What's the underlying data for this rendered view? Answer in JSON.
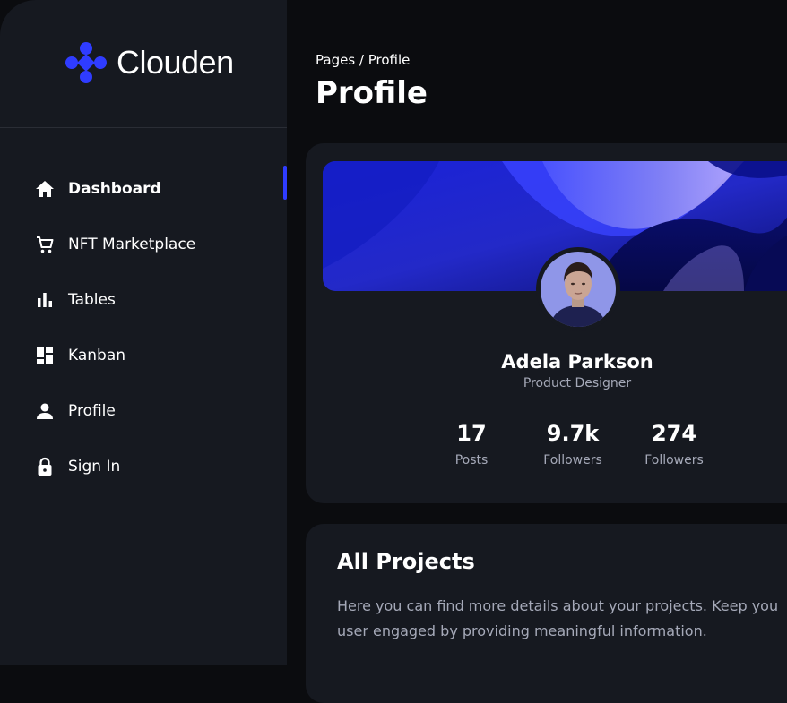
{
  "brand": {
    "name": "Clouden",
    "accent": "#2f3cff"
  },
  "sidebar": {
    "items": [
      {
        "label": "Dashboard",
        "icon": "home-icon",
        "active": true
      },
      {
        "label": "NFT Marketplace",
        "icon": "cart-icon",
        "active": false
      },
      {
        "label": "Tables",
        "icon": "bar-chart-icon",
        "active": false
      },
      {
        "label": "Kanban",
        "icon": "kanban-icon",
        "active": false
      },
      {
        "label": "Profile",
        "icon": "person-icon",
        "active": false
      },
      {
        "label": "Sign In",
        "icon": "lock-icon",
        "active": false
      }
    ]
  },
  "header": {
    "breadcrumb": "Pages / Profile",
    "title": "Profile"
  },
  "profile": {
    "name": "Adela Parkson",
    "role": "Product Designer",
    "stats": [
      {
        "value": "17",
        "label": "Posts"
      },
      {
        "value": "9.7k",
        "label": "Followers"
      },
      {
        "value": "274",
        "label": "Followers"
      }
    ]
  },
  "projects": {
    "title": "All Projects",
    "description": "Here you can find more details about your projects. Keep you user engaged by providing meaningful information."
  }
}
